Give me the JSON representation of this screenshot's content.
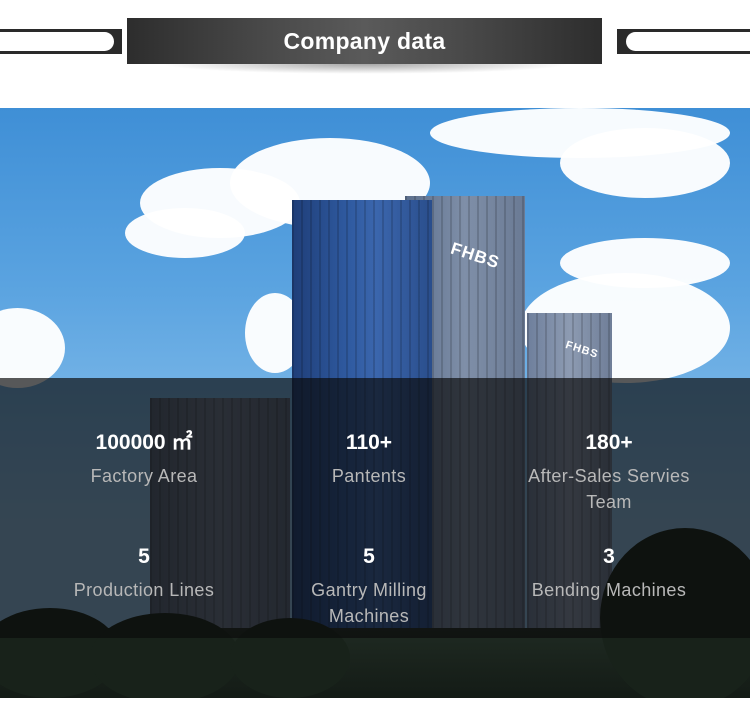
{
  "header": {
    "title": "Company data"
  },
  "hero": {
    "brand_sign": "FHBS"
  },
  "stats": [
    {
      "value": "100000 ㎡",
      "label": "Factory Area"
    },
    {
      "value": "110+",
      "label": "Pantents"
    },
    {
      "value": "180+",
      "label": "After-Sales Servies Team"
    },
    {
      "value": "5",
      "label": "Production Lines"
    },
    {
      "value": "5",
      "label": "Gantry Milling Machines"
    },
    {
      "value": "3",
      "label": "Bending Machines"
    }
  ],
  "colors": {
    "title_bar": "#4a4a4a",
    "overlay": "#0a0a0a",
    "stat_value": "#ffffff",
    "stat_label": "#b8b8b8",
    "sky": "#5aa3e0"
  }
}
